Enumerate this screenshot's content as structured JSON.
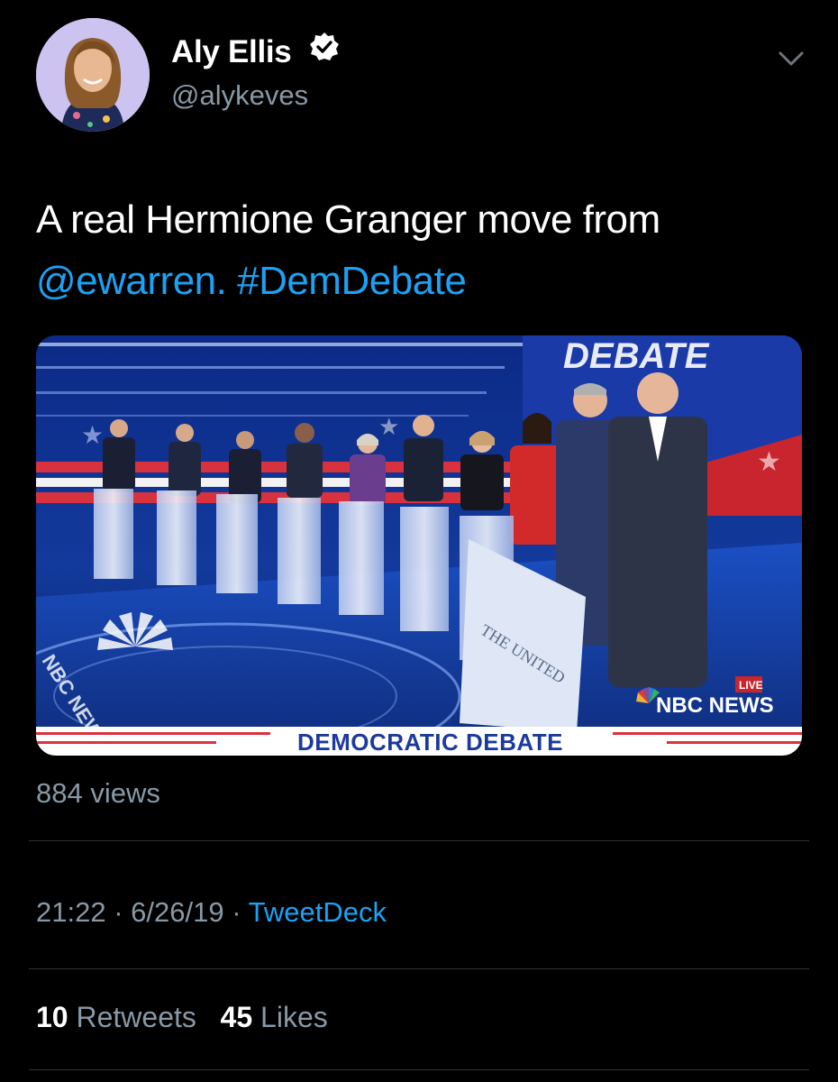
{
  "author": {
    "name": "Aly Ellis",
    "handle": "@alykeves",
    "verified": true,
    "avatar_icon": "profile-photo"
  },
  "tweet": {
    "text_line1": "A real Hermione Granger move from",
    "mention": "@ewarren.",
    "hashtag": "#DemDebate"
  },
  "media": {
    "banner_text": "DEMOCRATIC DEBATE",
    "corner_badge": "LIVE",
    "network_logo": "NBC NEWS",
    "stage_text": "NBC NEWS",
    "top_sign": "DEBATE",
    "podium_text": "THE UNITED"
  },
  "views": "884 views",
  "meta": {
    "time": "21:22",
    "date": "6/26/19",
    "separator": "·",
    "source": "TweetDeck"
  },
  "stats": {
    "retweets_count": "10",
    "retweets_label": "Retweets",
    "likes_count": "45",
    "likes_label": "Likes"
  },
  "colors": {
    "background": "#000000",
    "link": "#1da1f2",
    "secondary_text": "#8899a6"
  }
}
